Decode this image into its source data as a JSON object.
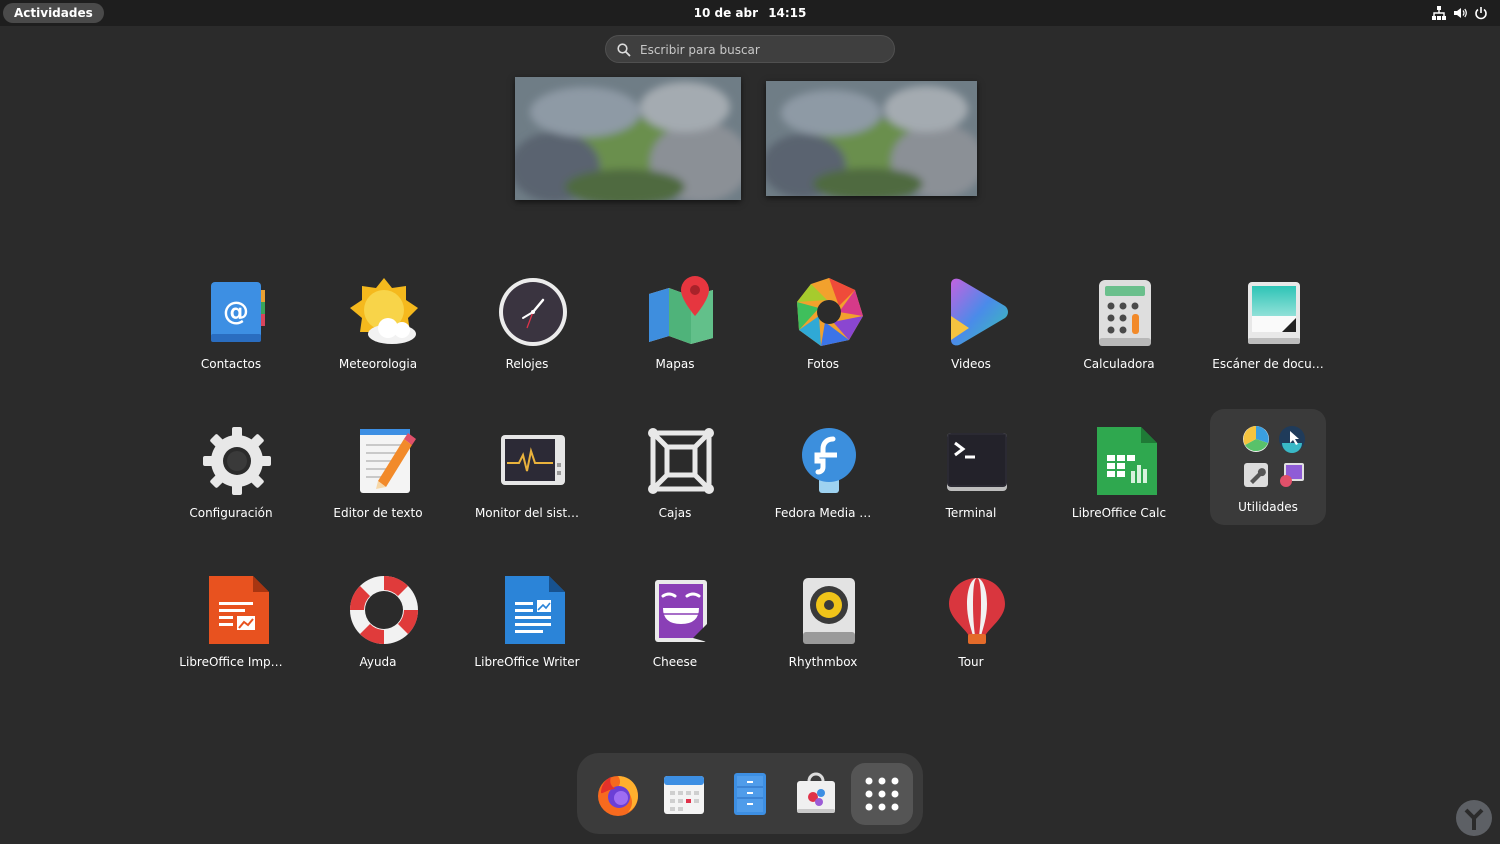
{
  "topbar": {
    "activities_label": "Actividades",
    "date": "10 de abr",
    "time": "14:15",
    "tray_icons": [
      "network-icon",
      "volume-icon",
      "power-icon"
    ]
  },
  "search": {
    "placeholder": "Escribir para buscar"
  },
  "workspaces": [
    "workspace-1",
    "workspace-2"
  ],
  "apps": [
    {
      "label": "Contactos"
    },
    {
      "label": "Meteorologia"
    },
    {
      "label": "Relojes"
    },
    {
      "label": "Mapas"
    },
    {
      "label": "Fotos"
    },
    {
      "label": "Videos"
    },
    {
      "label": "Calculadora"
    },
    {
      "label": "Escáner de docu…"
    },
    {
      "label": "Configuración"
    },
    {
      "label": "Editor de texto"
    },
    {
      "label": "Monitor del sist…"
    },
    {
      "label": "Cajas"
    },
    {
      "label": "Fedora Media …"
    },
    {
      "label": "Terminal"
    },
    {
      "label": "LibreOffice Calc"
    },
    {
      "label": "Utilidades"
    },
    {
      "label": "LibreOffice Imp…"
    },
    {
      "label": "Ayuda"
    },
    {
      "label": "LibreOffice Writer"
    },
    {
      "label": "Cheese"
    },
    {
      "label": "Rhythmbox"
    },
    {
      "label": "Tour"
    }
  ],
  "dock": [
    "firefox-icon",
    "calendar-icon",
    "files-icon",
    "software-icon",
    "show-apps-icon"
  ],
  "colors": {
    "background": "#2b2b2b",
    "topbar": "#1e1e1e",
    "dock": "#3b3b3b",
    "folder": "#3a3a3a"
  }
}
